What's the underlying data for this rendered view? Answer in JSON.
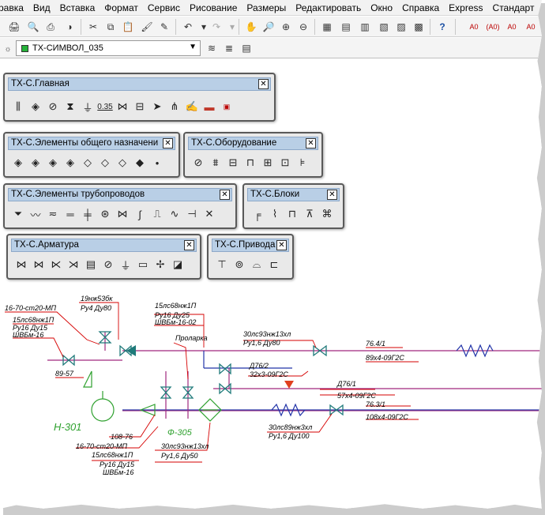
{
  "menu": [
    "равка",
    "Вид",
    "Вставка",
    "Формат",
    "Сервис",
    "Рисование",
    "Размеры",
    "Редактировать",
    "Окно",
    "Справка",
    "Express",
    "Стандарт"
  ],
  "layer": {
    "name": "ТХ-СИМВОЛ_035"
  },
  "palettes": {
    "main": {
      "title": "ТХ-С.Главная",
      "close": "✕"
    },
    "general": {
      "title": "ТХ-С.Элементы общего назначени",
      "close": "✕"
    },
    "equipment": {
      "title": "ТХ-С.Оборудование",
      "close": "✕"
    },
    "pipes": {
      "title": "ТХ-С.Элементы трубопроводов",
      "close": "✕"
    },
    "blocks": {
      "title": "ТХ-С.Блоки",
      "close": "✕"
    },
    "valves": {
      "title": "ТХ-С.Арматура",
      "close": "✕"
    },
    "drives": {
      "title": "ТХ-С.Привода",
      "close": "✕"
    }
  },
  "main_icon_label": "0.35",
  "drawing_labels": {
    "l1": "16-70-ст20-МП",
    "l2": "15лс68нж1П",
    "l3": "Ру16 Ду15",
    "l4": "ШВБм-16",
    "l5": "19нж53бк",
    "l6": "Ру4 Ду80",
    "l7": "15лс68нж1П",
    "l8": "Ру16 Ду25",
    "l9": "ШВБм-16-02",
    "l10": "Проларка",
    "l11": "30лс93нж13хл",
    "l12": "Ру1,6 Ду80",
    "l13": "76.4/1",
    "l14": "89х4-09Г2С",
    "l15": "Д76/2",
    "l16": "32х3-09Г2С",
    "l17": "Д76/1",
    "l18": "57х4-09Г2С",
    "l19": "76.3/1",
    "l20": "108х4-09Г2С",
    "l21": "30лс89нж3хл",
    "l22": "Ру1,6 Ду100",
    "l23": "89-57",
    "l24": "Н-301",
    "l25": "108-76",
    "l26": "16-70-ст20-МП",
    "l27": "15лс68нж1П",
    "l28": "Ру16 Ду15",
    "l29": "ШВБм-16",
    "l30": "Ф-305",
    "l31": "30лс93нж13хл",
    "l32": "Ру1,6 Ду50"
  },
  "colors": {
    "pipe": "#a0287e",
    "pipe2": "#7b2b8f",
    "leader": "#d60000",
    "equipment": "#2fa12f",
    "valve": "#1f7a7a",
    "blue": "#2234a8",
    "arrow": "#e0401f"
  }
}
